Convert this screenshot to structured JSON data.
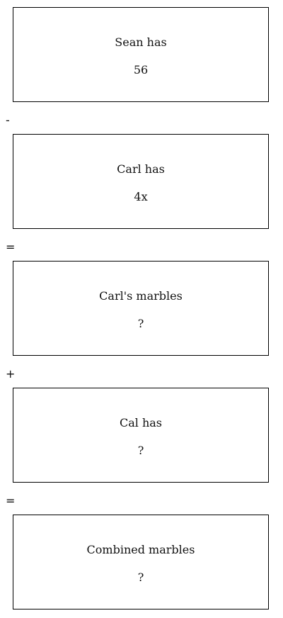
{
  "boxes": [
    {
      "label": "Sean has",
      "value": "56"
    },
    {
      "label": "Carl has",
      "value": "4x"
    },
    {
      "label": "Carl's marbles",
      "value": "?"
    },
    {
      "label": "Cal has",
      "value": "?"
    },
    {
      "label": "Combined marbles",
      "value": "?"
    }
  ],
  "operators": [
    "-",
    "=",
    "+",
    "="
  ]
}
